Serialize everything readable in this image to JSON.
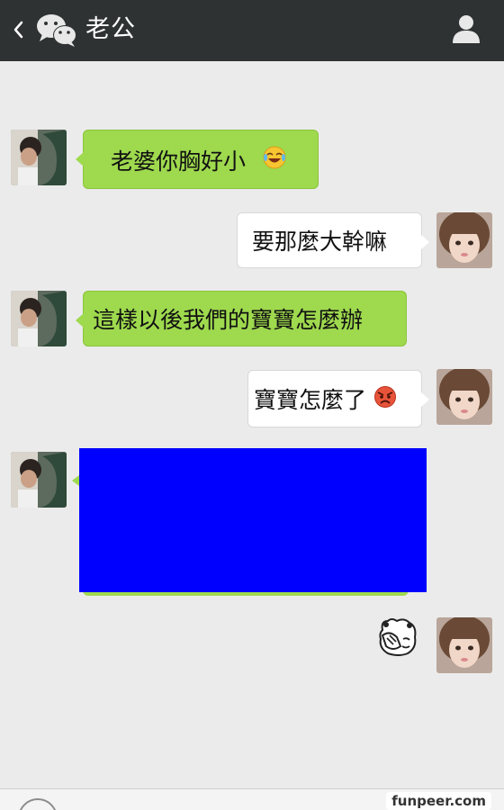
{
  "header": {
    "title": "老公",
    "back_icon": "chevron-left-icon",
    "logo_icon": "wechat-logo-icon",
    "profile_icon": "person-icon"
  },
  "messages": [
    {
      "side": "left",
      "text": "老婆你胸好小",
      "emoji": "laughing-tears-emoji"
    },
    {
      "side": "right",
      "text": "要那麼大幹嘛"
    },
    {
      "side": "left",
      "text": "這樣以後我們的寶寶怎麼辦"
    },
    {
      "side": "right",
      "text": "寶寶怎麼了",
      "emoji": "angry-face-emoji"
    },
    {
      "side": "left",
      "redacted": true,
      "redaction_color": "#0000ff"
    },
    {
      "side": "right",
      "sticker": "facepalm-sticker"
    }
  ],
  "colors": {
    "header_bg": "#2f3233",
    "chat_bg": "#ebebeb",
    "green_bubble": "#9ed94e",
    "white_bubble": "#ffffff"
  },
  "watermark": "funpeer.com"
}
